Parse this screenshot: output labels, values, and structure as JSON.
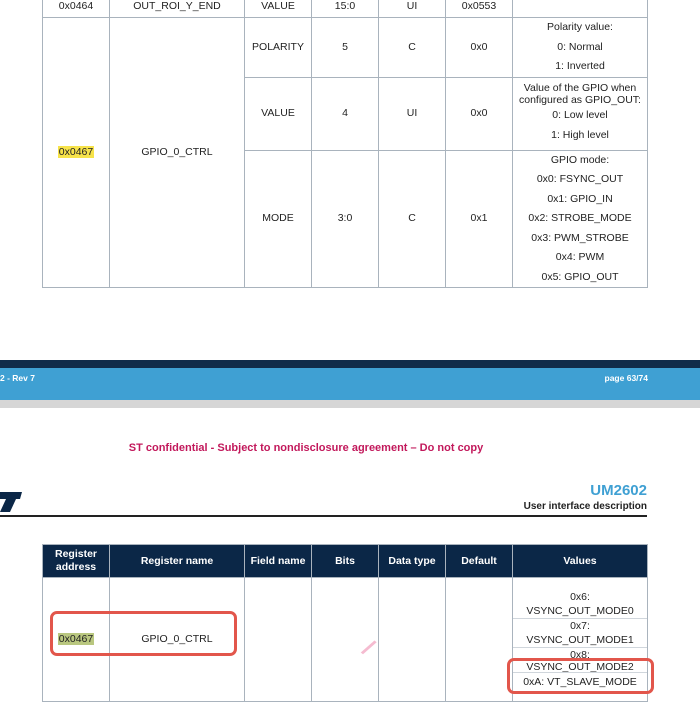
{
  "top_table": {
    "row_end": {
      "address": "0x0464",
      "name": "OUT_ROI_Y_END",
      "field": "VALUE",
      "bits": "15:0",
      "type": "UI",
      "default": "0x0553"
    },
    "gpio_row": {
      "address": "0x0467",
      "name": "GPIO_0_CTRL",
      "fields": [
        {
          "field": "POLARITY",
          "bits": "5",
          "type": "C",
          "default": "0x0",
          "values": [
            "Polarity value:",
            "0: Normal",
            "1: Inverted"
          ]
        },
        {
          "field": "VALUE",
          "bits": "4",
          "type": "UI",
          "default": "0x0",
          "values": [
            "Value of the GPIO when",
            "configured as GPIO_OUT:",
            "0: Low level",
            "1: High level"
          ]
        },
        {
          "field": "MODE",
          "bits": "3:0",
          "type": "C",
          "default": "0x1",
          "values": [
            "GPIO mode:",
            "0x0: FSYNC_OUT",
            "0x1: GPIO_IN",
            "0x2: STROBE_MODE",
            "0x3: PWM_STROBE",
            "0x4: PWM",
            "0x5: GPIO_OUT"
          ]
        }
      ]
    }
  },
  "footer": {
    "rev": "2 - Rev 7",
    "page": "page 63/74"
  },
  "confidential": "ST confidential - Subject to nondisclosure agreement – Do not copy",
  "header": {
    "doc_id": "UM2602",
    "section": "User interface description"
  },
  "bottom_table": {
    "headers": {
      "address": "Register address",
      "name": "Register name",
      "field": "Field name",
      "bits": "Bits",
      "type": "Data type",
      "default": "Default",
      "values": "Values"
    },
    "row": {
      "address": "0x0467",
      "name": "GPIO_0_CTRL",
      "values": [
        "0x6:",
        "VSYNC_OUT_MODE0",
        "0x7:",
        "VSYNC_OUT_MODE1",
        "0x8:",
        "VSYNC_OUT_MODE2",
        "0xA: VT_SLAVE_MODE"
      ]
    }
  },
  "colors": {
    "accent_blue": "#3fa0d3",
    "header_navy": "#0b2747",
    "confidential_magenta": "#c2185b",
    "highlight": "#f7e34a",
    "annotation_red": "#e2564b"
  }
}
